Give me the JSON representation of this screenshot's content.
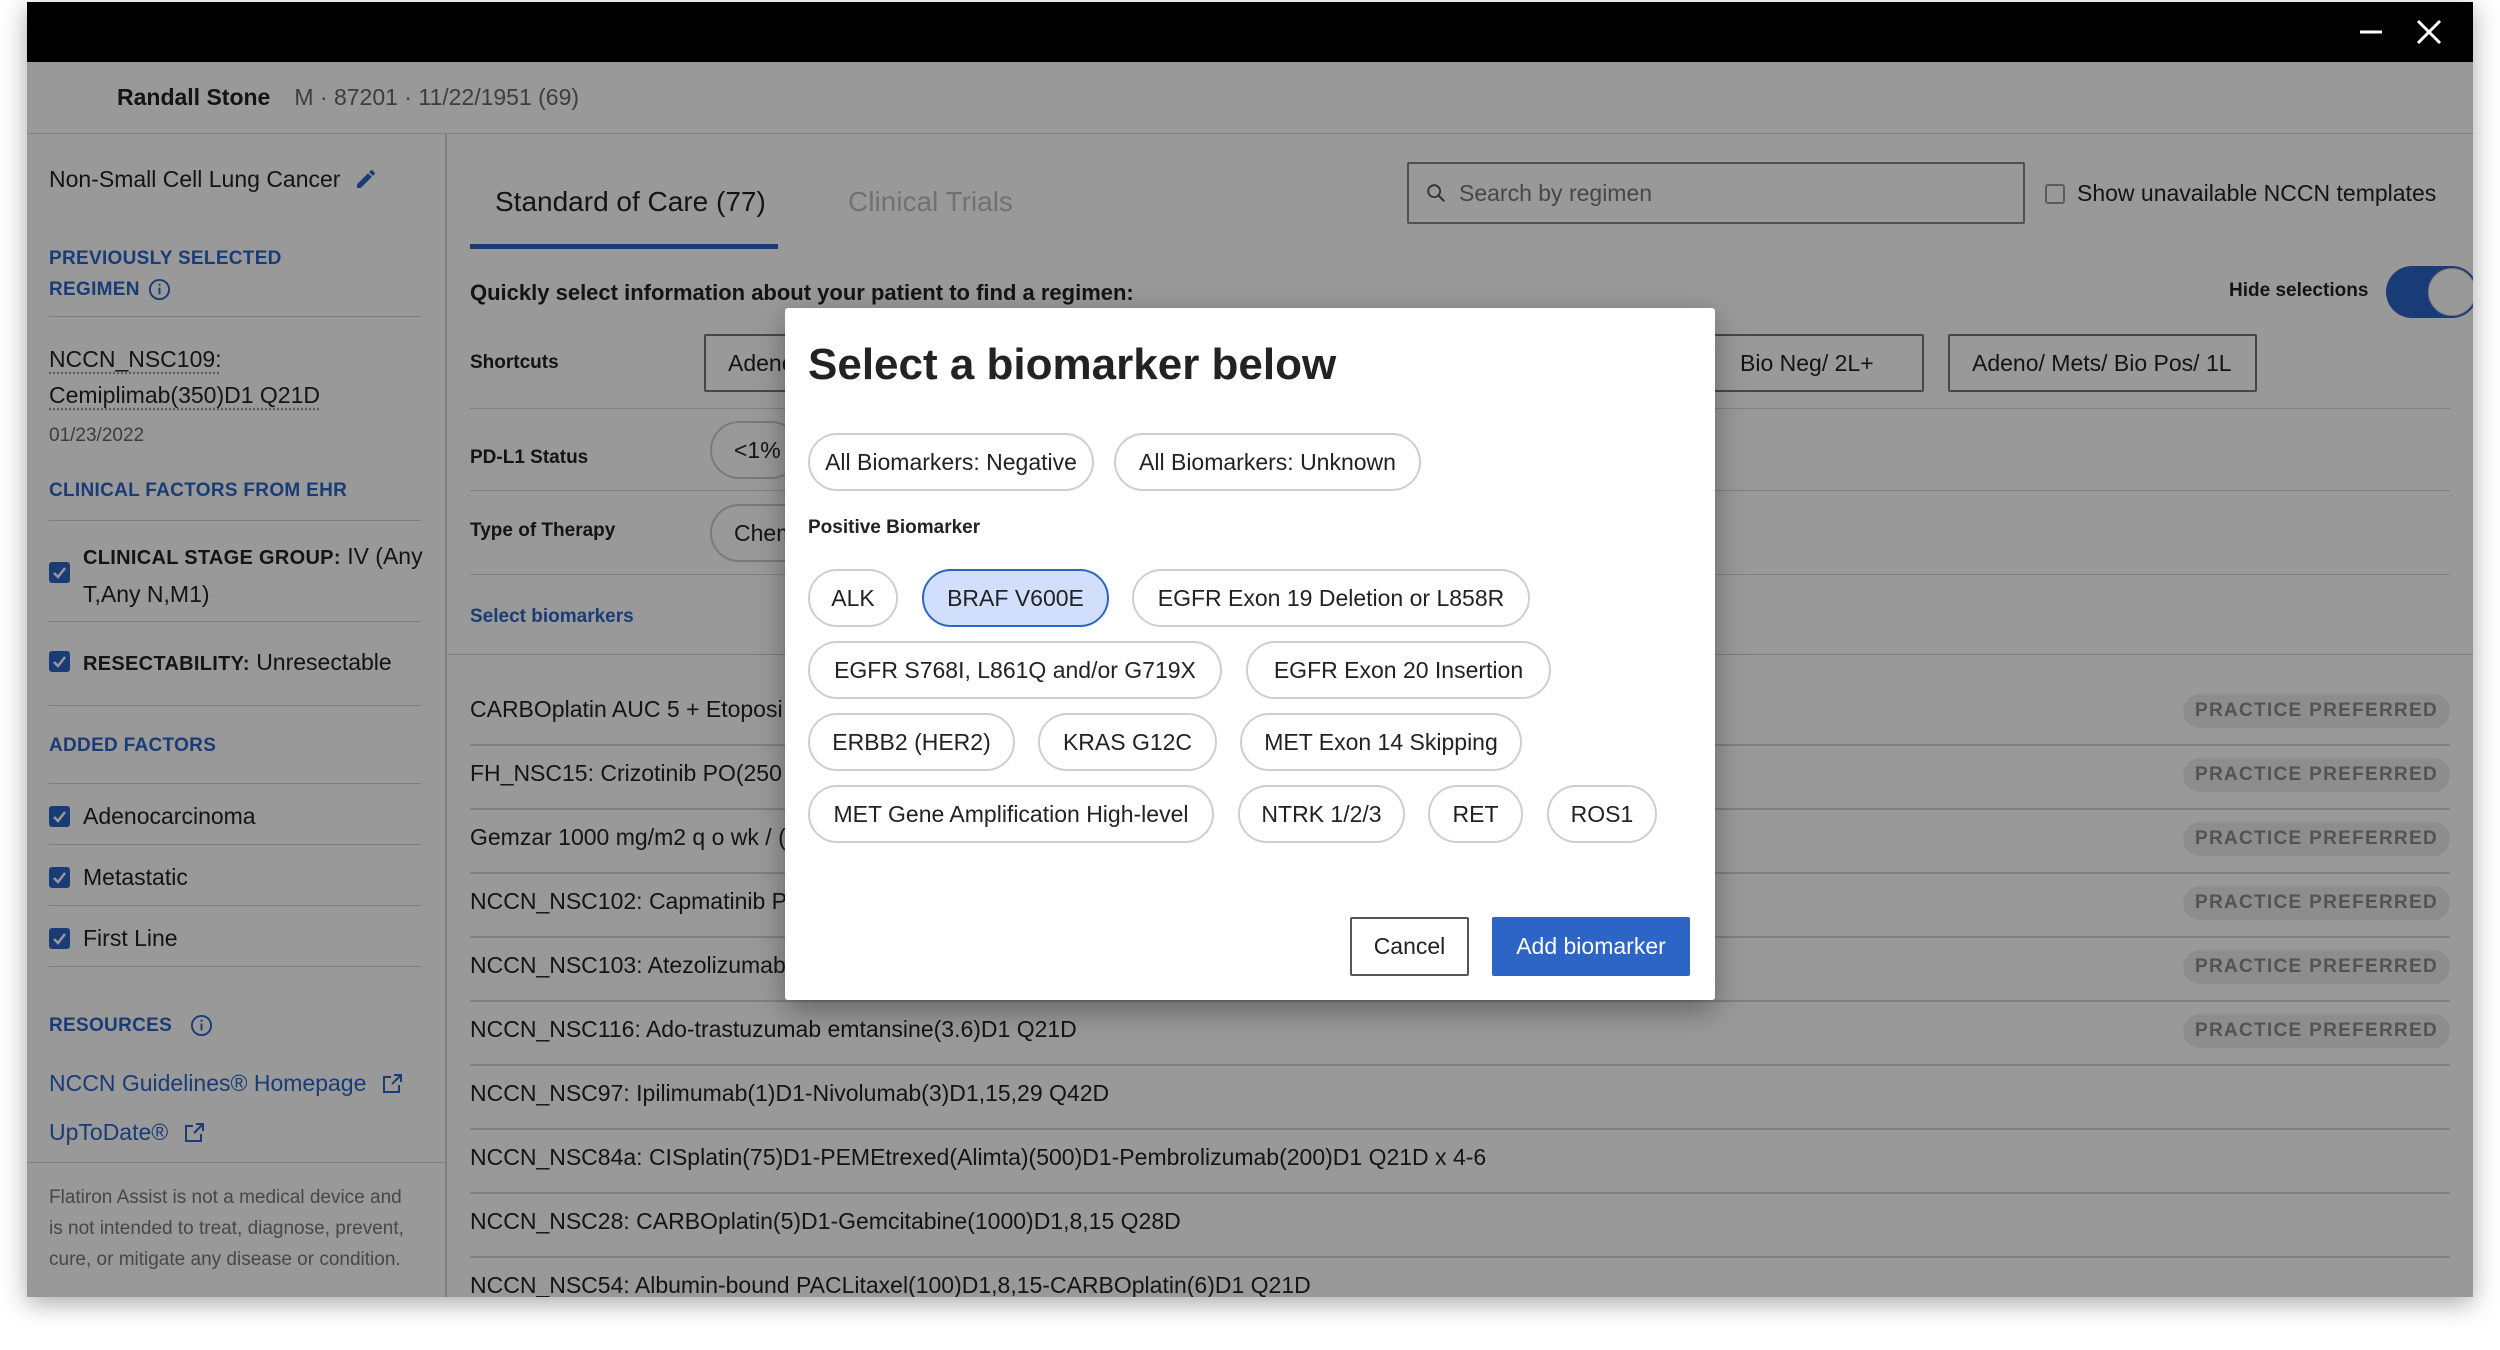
{
  "colors": {
    "accent": "#2c65c5",
    "selected_chip": "#d2dffc",
    "titlebar": "#000000",
    "badge_bg": "#ececec"
  },
  "window": {
    "minimize_icon": "minimize-icon",
    "close_icon": "close-icon"
  },
  "patient": {
    "name": "Randall Stone",
    "info": "M · 87201 · 11/22/1951 (69)"
  },
  "sidebar": {
    "diagnosis": "Non-Small Cell Lung Cancer",
    "prev_heading_1": "PREVIOUSLY SELECTED",
    "prev_heading_2": "REGIMEN",
    "prev_regimen_1": "NCCN_NSC109:",
    "prev_regimen_2": "Cemiplimab(350)D1 Q21D",
    "prev_date": "01/23/2022",
    "clinical_heading": "CLINICAL FACTORS FROM EHR",
    "clinical": [
      {
        "key": "CLINICAL STAGE GROUP:",
        "value_1": "IV (Any",
        "value_2": "T,Any N,M1)"
      },
      {
        "key": "RESECTABILITY:",
        "value": "Unresectable"
      }
    ],
    "added_heading": "ADDED FACTORS",
    "added": [
      "Adenocarcinoma",
      "Metastatic",
      "First Line"
    ],
    "resources_heading": "RESOURCES",
    "links": [
      "NCCN Guidelines® Homepage",
      "UpToDate®"
    ],
    "disclaimer_1": "Flatiron Assist is not a medical device and",
    "disclaimer_2": "is not intended to treat, diagnose, prevent,",
    "disclaimer_3": "cure, or mitigate any disease or condition."
  },
  "main": {
    "tabs": [
      {
        "label": "Standard of Care (77)",
        "active": true
      },
      {
        "label": "Clinical Trials",
        "active": false
      }
    ],
    "search_placeholder": "Search by regimen",
    "show_unavailable": "Show unavailable NCCN templates",
    "quick_select": "Quickly select information about your patient to find a regimen:",
    "hide_selections": "Hide selections",
    "shortcuts_label": "Shortcuts",
    "shortcuts": [
      "Adeno/",
      "Bio Neg/ 2L+",
      "Adeno/ Mets/ Bio Pos/ 1L"
    ],
    "pdl1_label": "PD-L1 Status",
    "pdl1_options": [
      "<1%"
    ],
    "therapy_label": "Type of Therapy",
    "therapy_options": [
      "Chemo/"
    ],
    "select_biomarkers": "Select biomarkers",
    "regimens": [
      {
        "name": "CARBOplatin AUC 5 + Etoposi",
        "badge": "PRACTICE PREFERRED"
      },
      {
        "name": "FH_NSC15: Crizotinib PO(250",
        "badge": "PRACTICE PREFERRED"
      },
      {
        "name": "Gemzar 1000 mg/m2 q o wk / (",
        "badge": "PRACTICE PREFERRED"
      },
      {
        "name": "NCCN_NSC102: Capmatinib P",
        "badge": "PRACTICE PREFERRED"
      },
      {
        "name": "NCCN_NSC103: Atezolizumab",
        "badge": "PRACTICE PREFERRED"
      },
      {
        "name": "NCCN_NSC116: Ado-trastuzumab emtansine(3.6)D1 Q21D",
        "badge": "PRACTICE PREFERRED"
      },
      {
        "name": "NCCN_NSC97: Ipilimumab(1)D1-Nivolumab(3)D1,15,29 Q42D",
        "badge": ""
      },
      {
        "name": "NCCN_NSC84a: CISplatin(75)D1-PEMEtrexed(Alimta)(500)D1-Pembrolizumab(200)D1 Q21D x 4-6",
        "badge": ""
      },
      {
        "name": "NCCN_NSC28: CARBOplatin(5)D1-Gemcitabine(1000)D1,8,15 Q28D",
        "badge": ""
      },
      {
        "name": "NCCN_NSC54: Albumin-bound PACLitaxel(100)D1,8,15-CARBOplatin(6)D1 Q21D",
        "badge": ""
      }
    ]
  },
  "modal": {
    "title": "Select a biomarker below",
    "general_options": [
      "All Biomarkers: Negative",
      "All Biomarkers: Unknown"
    ],
    "positive_label": "Positive Biomarker",
    "biomarkers": [
      {
        "label": "ALK",
        "selected": false
      },
      {
        "label": "BRAF V600E",
        "selected": true
      },
      {
        "label": "EGFR Exon 19 Deletion or L858R",
        "selected": false
      },
      {
        "label": "EGFR S768I, L861Q and/or G719X",
        "selected": false
      },
      {
        "label": "EGFR Exon 20 Insertion",
        "selected": false
      },
      {
        "label": "ERBB2 (HER2)",
        "selected": false
      },
      {
        "label": "KRAS G12C",
        "selected": false
      },
      {
        "label": "MET Exon 14 Skipping",
        "selected": false
      },
      {
        "label": "MET Gene Amplification High-level",
        "selected": false
      },
      {
        "label": "NTRK 1/2/3",
        "selected": false
      },
      {
        "label": "RET",
        "selected": false
      },
      {
        "label": "ROS1",
        "selected": false
      }
    ],
    "cancel": "Cancel",
    "add": "Add biomarker"
  }
}
